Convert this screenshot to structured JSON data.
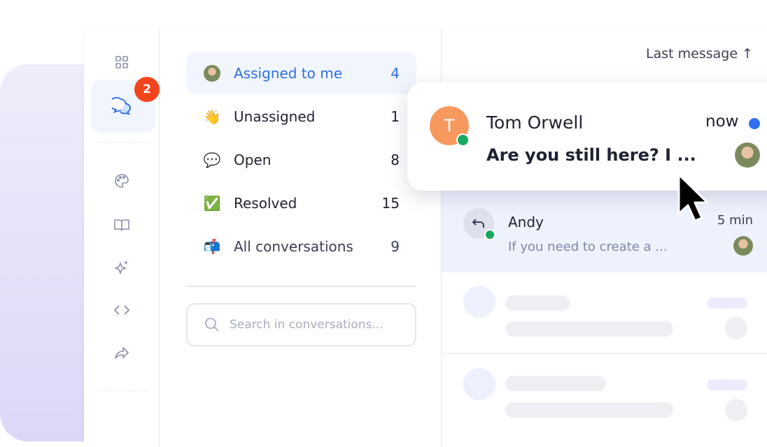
{
  "rail": {
    "icons": [
      "grid-icon",
      "chat-icon",
      "palette-icon",
      "book-icon",
      "sparkles-icon",
      "code-icon",
      "share-icon"
    ],
    "chat_badge": "2"
  },
  "filters": [
    {
      "icon": "avatar",
      "label": "Assigned to me",
      "count": "4",
      "selected": true
    },
    {
      "icon": "👋",
      "label": "Unassigned",
      "count": "1"
    },
    {
      "icon": "💬",
      "label": "Open",
      "count": "8"
    },
    {
      "icon": "✅",
      "label": "Resolved",
      "count": "15"
    },
    {
      "icon": "📬",
      "label": "All conversations",
      "count": "9"
    }
  ],
  "search": {
    "placeholder": "Search in conversations..."
  },
  "sort": {
    "label": "Last message ↑"
  },
  "conversations": [
    {
      "initial": "T",
      "name": "Tom Orwell",
      "time": "now",
      "preview": "Are you still here? I ...",
      "unread": true,
      "avatar_color": "#f7995f"
    },
    {
      "name": "Andy",
      "time": "5 min",
      "preview": "If you need to create a ..."
    }
  ],
  "colors": {
    "accent": "#2f6fe0",
    "badge": "#f2451c",
    "online": "#19a862",
    "unread": "#2f6ff0"
  }
}
